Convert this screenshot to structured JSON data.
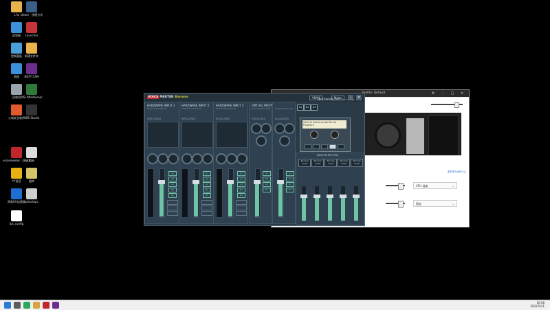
{
  "desktop_icons": [
    {
      "label": "c.ho",
      "icon": "folder-icon",
      "color": "#e8b34a"
    },
    {
      "label": "steam · 快捷方式",
      "icon": "steam-icon",
      "color": "#3a5f88"
    },
    {
      "label": "此电脑",
      "icon": "computer-icon",
      "color": "#3c8fd8"
    },
    {
      "label": "Launcher",
      "icon": "app-icon",
      "color": "#c4343a"
    },
    {
      "label": "控制面板",
      "icon": "control-panel-icon",
      "color": "#4aa0d8"
    },
    {
      "label": "新建文件夹",
      "icon": "folder-icon",
      "color": "#e8b34a"
    },
    {
      "label": "网络",
      "icon": "network-icon",
      "color": "#3c8fd8"
    },
    {
      "label": "NEXT CAM",
      "icon": "cam-icon",
      "color": "#6b2e8e"
    },
    {
      "label": "回收站",
      "icon": "recycle-bin-icon",
      "color": "#9aa4ac"
    },
    {
      "label": "MSI Afterburner",
      "icon": "afterburner-icon",
      "color": "#2f7a3a"
    },
    {
      "label": "火绒安全软件",
      "icon": "shield-icon",
      "color": "#e15a2e"
    },
    {
      "label": "OBS Studio",
      "icon": "obs-icon",
      "color": "#333"
    },
    {
      "label": "voicemeeter · 快捷方式",
      "icon": "voicemeeter-icon",
      "color": "#c2262d"
    },
    {
      "label": "相册",
      "icon": "image-icon",
      "color": "#dcdcdc"
    },
    {
      "label": "YY语音",
      "icon": "yy-icon",
      "color": "#e8b012"
    },
    {
      "label": "图库",
      "icon": "image-icon",
      "color": "#d3c46a"
    },
    {
      "label": "网易UU加速器",
      "icon": "uu-icon",
      "color": "#1f6fd0"
    },
    {
      "label": "unlocktps",
      "icon": "image-icon",
      "color": "#cfcfcf"
    },
    {
      "label": "fps_config",
      "icon": "file-icon",
      "color": "#ffffff"
    }
  ],
  "voicemeeter": {
    "brand_v": "VOICE",
    "brand_m": "MEETER",
    "brand_b": "Banana",
    "vban": "VBAN",
    "menu": "Menu",
    "strips": [
      {
        "title": "HARDWARE INPUT 1",
        "sub": "Select Input Device",
        "intellipan": "INTELLIPAN",
        "knob_l": "Comp",
        "knob_m": "AUDIBILITY",
        "knob_r": "Gate",
        "fader_label": "Fader Gain"
      },
      {
        "title": "HARDWARE INPUT 2",
        "sub": "Select Input Device",
        "intellipan": "INTELLIPAN",
        "knob_l": "Comp",
        "knob_m": "AUDIBILITY",
        "knob_r": "Gate",
        "fader_label": "Fader Gain"
      },
      {
        "title": "HARDWARE INPUT 3",
        "sub": "Select Input Device",
        "intellipan": "INTELLIPAN",
        "knob_l": "Comp",
        "knob_m": "AUDIBILITY",
        "knob_r": "Gate",
        "fader_label": "Fader Gain"
      }
    ],
    "virtual": {
      "title": "VIRTUAL INPUTS",
      "sub1": "Voicemeeter VAIO",
      "sub2": "Voicemeeter AUX",
      "eq1": "EQUALIZER",
      "eq2": "EQUALIZER"
    },
    "hw_out": {
      "title": "HARDWARE OUT",
      "sub": "48 kHz / 512"
    },
    "a_buttons": [
      "A1",
      "A2",
      "A3"
    ],
    "b_buttons": [
      "B1",
      "B2"
    ],
    "cassette": {
      "label": "Click to Select Audio file for Playback",
      "rec": "REC"
    },
    "master": {
      "title": "MASTER SECTION",
      "cols": [
        "Normal mode",
        "Normal mode",
        "Normal mode",
        "Normal mode",
        "Normal mode"
      ]
    }
  },
  "window2": {
    "title": "Profile: Default",
    "link": "前往Kraken 以",
    "row1": {
      "dropdown": "CPU 温度"
    },
    "row2": {
      "dropdown": "固定"
    }
  },
  "taskbar": {
    "time": "10:56",
    "date": "2022/5/21"
  }
}
